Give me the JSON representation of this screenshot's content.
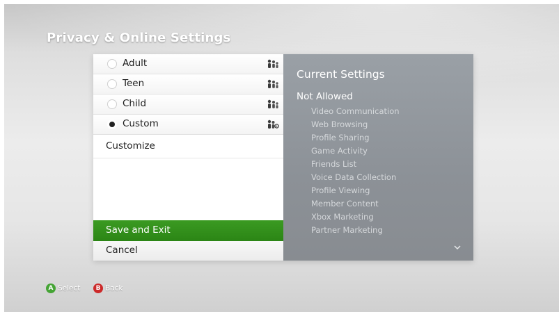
{
  "page_title": "Privacy & Online Settings",
  "options": [
    {
      "label": "Adult",
      "selected": false,
      "icon": "family-icon"
    },
    {
      "label": "Teen",
      "selected": false,
      "icon": "family-icon"
    },
    {
      "label": "Child",
      "selected": false,
      "icon": "family-icon"
    },
    {
      "label": "Custom",
      "selected": true,
      "icon": "family-custom-icon"
    }
  ],
  "actions": {
    "customize": "Customize",
    "save_and_exit": "Save and Exit",
    "cancel": "Cancel"
  },
  "current_settings": {
    "title": "Current Settings",
    "status": "Not Allowed",
    "items": [
      "Video Communication",
      "Web Browsing",
      "Profile Sharing",
      "Game Activity",
      "Friends List",
      "Voice Data Collection",
      "Profile Viewing",
      "Member Content",
      "Xbox Marketing",
      "Partner Marketing"
    ]
  },
  "footer": {
    "a_glyph": "A",
    "a_label": "Select",
    "b_glyph": "B",
    "b_label": "Back"
  },
  "colors": {
    "accent_green": "#2f8a1a",
    "button_a": "#45a435",
    "button_b": "#cc2a2a",
    "info_panel": "#90959b"
  }
}
